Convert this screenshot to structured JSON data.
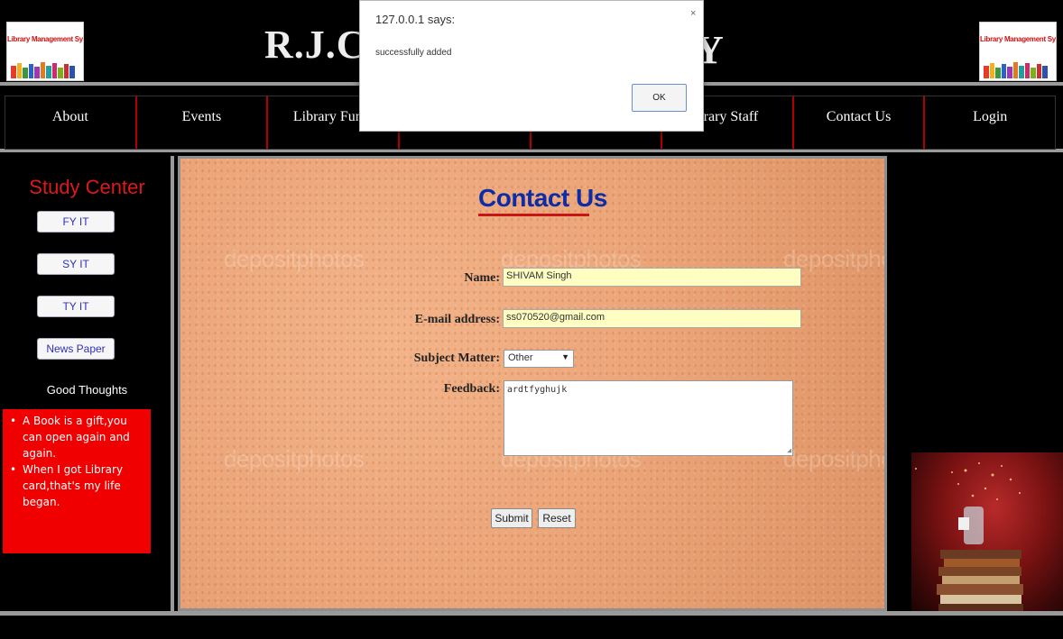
{
  "header": {
    "logo_text": "Library Management System",
    "title_visible": "R.J.C",
    "title_tail_visible": "Y"
  },
  "nav": {
    "items": [
      "About",
      "Events",
      "Library Funct",
      "",
      "",
      "brary Staff",
      "Contact Us",
      "Login"
    ]
  },
  "sidebar": {
    "title": "Study Center",
    "buttons": [
      "FY IT",
      "SY IT",
      "TY IT",
      "News Paper"
    ],
    "good_thoughts_label": "Good Thoughts",
    "thoughts": [
      "A Book is a gift,you can open again and again.",
      "When I got Library card,that's my life began."
    ]
  },
  "main": {
    "heading": "Contact Us",
    "watermark": "depositphotos",
    "form": {
      "name_label": "Name:",
      "name_value": "SHIVAM Singh",
      "email_label": "E-mail address:",
      "email_value": "ss070520@gmail.com",
      "subject_label": "Subject Matter:",
      "subject_value": "Other",
      "feedback_label": "Feedback:",
      "feedback_value": "ardtfyghujk",
      "submit_label": "Submit",
      "reset_label": "Reset"
    }
  },
  "dialog": {
    "title": "127.0.0.1 says:",
    "message": "successfully added",
    "ok_label": "OK",
    "close_glyph": "×"
  },
  "colors": {
    "accent_red": "#f00000",
    "heading_blue": "#0d2ca8",
    "input_yellow": "#fefdc2",
    "sidebar_title_red": "#e01818"
  }
}
